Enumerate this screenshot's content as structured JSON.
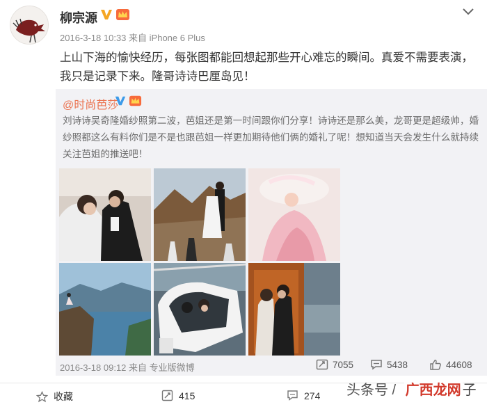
{
  "post": {
    "username": "柳宗源",
    "timestamp": "2016-3-18 10:33",
    "source": "来自 iPhone 6 Plus",
    "text": "上山下海的愉快经历，每张图都能回想起那些开心难忘的瞬间。真爱不需要表演，我只是记录下来。隆哥诗诗巴厘岛见！",
    "icons": {
      "verified": "verified-v-icon",
      "member": "member-crown-icon",
      "menu": "chevron-down-icon"
    }
  },
  "repost": {
    "username": "@时尚芭莎",
    "text": "刘诗诗吴奇隆婚纱照第二波，芭姐还是第一时间跟你们分享！诗诗还是那么美，龙哥更是超级帅，婚纱照都这么有料你们是不是也跟芭姐一样更加期待他们俩的婚礼了呢！想知道当天会发生什么就持续关注芭姐的推送吧！",
    "photos": [
      "wedding-photo-couple-indoor",
      "wedding-photo-chess-mountain",
      "wedding-photo-pink-dress",
      "wedding-photo-cliff-lake",
      "wedding-photo-helicopter",
      "wedding-photo-wooden-door"
    ],
    "footer": {
      "time": "2016-3-18 09:12",
      "source": "来自 专业版微博",
      "reposts": "7055",
      "comments": "5438",
      "likes": "44608"
    }
  },
  "actions": {
    "favorite": "收藏",
    "repost": "415",
    "comment": "274"
  },
  "watermark": {
    "prefix": "头条号 / ",
    "site": "广西龙网",
    "tail": "子"
  },
  "colors": {
    "orange_link": "#eb7350",
    "verified": "#f5a623",
    "repost_bg": "#f2f2f5",
    "meta_gray": "#8a8a8a"
  }
}
